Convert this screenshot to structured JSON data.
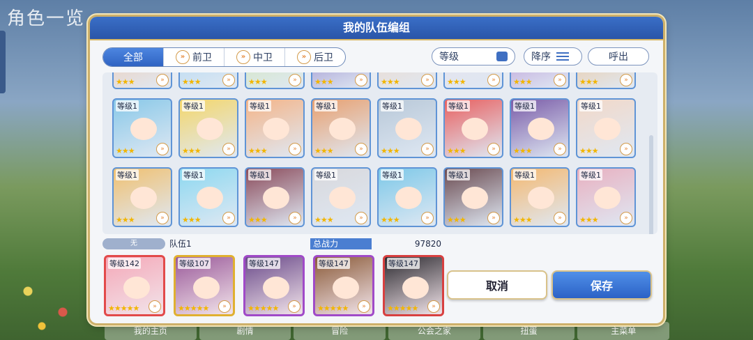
{
  "background": {
    "title": "角色一览",
    "bottom_nav": [
      "我的主页",
      "剧情",
      "冒险",
      "公会之家",
      "扭蛋",
      "主菜单"
    ]
  },
  "dialog": {
    "title": "我的队伍编组",
    "tabs": [
      {
        "label": "全部",
        "active": true,
        "icon": ""
      },
      {
        "label": "前卫",
        "active": false,
        "icon": "chevron-icon"
      },
      {
        "label": "中卫",
        "active": false,
        "icon": "chevron-icon"
      },
      {
        "label": "后卫",
        "active": false,
        "icon": "chevron-icon"
      }
    ],
    "sort_field": "等级",
    "sort_order": "降序",
    "recall": "呼出",
    "roster": {
      "rows": [
        [
          {
            "level": "",
            "stars": "★★★",
            "color": "#f3c7a8"
          },
          {
            "level": "",
            "stars": "★★★",
            "color": "#a9d4f0"
          },
          {
            "level": "",
            "stars": "★★★",
            "color": "#cfe6b0"
          },
          {
            "level": "",
            "stars": "★★★",
            "color": "#8c7cc4"
          },
          {
            "level": "",
            "stars": "★★★",
            "color": "#f1d5c0"
          },
          {
            "level": "",
            "stars": "★★★",
            "color": "#e6e0ea"
          },
          {
            "level": "",
            "stars": "★★★",
            "color": "#b28ad0"
          },
          {
            "level": "",
            "stars": "★★★",
            "color": "#f0c08a"
          }
        ],
        [
          {
            "level": "等级1",
            "stars": "★★★",
            "color": "#88c8e8"
          },
          {
            "level": "等级1",
            "stars": "★★★",
            "color": "#f4d66a"
          },
          {
            "level": "等级1",
            "stars": "★★★",
            "color": "#f4b488"
          },
          {
            "level": "等级1",
            "stars": "★★★",
            "color": "#e8a070"
          },
          {
            "level": "等级1",
            "stars": "★★★",
            "color": "#b8c8d8"
          },
          {
            "level": "等级1",
            "stars": "★★★",
            "color": "#e86060"
          },
          {
            "level": "等级1",
            "stars": "★★★",
            "color": "#7a5ca8"
          },
          {
            "level": "等级1",
            "stars": "★★★",
            "color": "#f2d8c8"
          }
        ],
        [
          {
            "level": "等级1",
            "stars": "★★★",
            "color": "#f0c070"
          },
          {
            "level": "等级1",
            "stars": "★★★",
            "color": "#8cd8f0"
          },
          {
            "level": "等级1",
            "stars": "★★★",
            "color": "#8a4a5a"
          },
          {
            "level": "等级1",
            "stars": "★★★",
            "color": "#d8d8dc"
          },
          {
            "level": "等级1",
            "stars": "★★★",
            "color": "#7cc8e8"
          },
          {
            "level": "等级1",
            "stars": "★★★",
            "color": "#6a4a50"
          },
          {
            "level": "等级1",
            "stars": "★★★",
            "color": "#f4b870"
          },
          {
            "level": "等级1",
            "stars": "★★★",
            "color": "#e8b0c0"
          }
        ]
      ]
    },
    "team": {
      "none_label": "无",
      "name": "队伍1",
      "power_label": "总战力",
      "power_value": "97820",
      "members": [
        {
          "level": "等级142",
          "stars": "★★★★★",
          "color": "#f4a8b8",
          "border": "#e24a4a"
        },
        {
          "level": "等级107",
          "stars": "★★★★★",
          "color": "#9a5a9a",
          "border": "#e0b030"
        },
        {
          "level": "等级147",
          "stars": "★★★★★",
          "color": "#6a4a8a",
          "border": "#a04ac8"
        },
        {
          "level": "等级147",
          "stars": "★★★★★",
          "color": "#8a5a38",
          "border": "#a04ac8"
        },
        {
          "level": "等级147",
          "stars": "★★★★★",
          "color": "#2c2a30",
          "border": "#d84040"
        }
      ]
    },
    "cancel": "取消",
    "save": "保存"
  }
}
